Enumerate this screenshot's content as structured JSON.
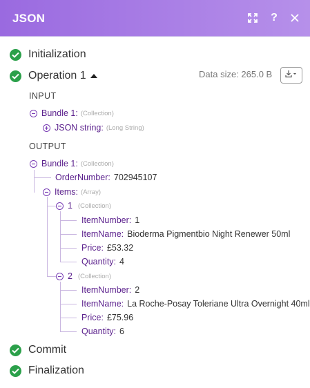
{
  "header": {
    "title": "JSON",
    "help_label": "?"
  },
  "stages": {
    "initialization": "Initialization",
    "operation": "Operation 1",
    "commit": "Commit",
    "finalization": "Finalization"
  },
  "operation": {
    "data_size": "Data size: 265.0 B"
  },
  "input": {
    "section_label": "INPUT",
    "bundle_key": "Bundle 1:",
    "bundle_type": "(Collection)",
    "json_key": "JSON string:",
    "json_type": "(Long String)"
  },
  "output": {
    "section_label": "OUTPUT",
    "bundle_key": "Bundle 1:",
    "bundle_type": "(Collection)",
    "order_key": "OrderNumber:",
    "order_value": "702945107",
    "items_key": "Items:",
    "items_type": "(Array)",
    "items": [
      {
        "index": "1",
        "type": "(Collection)",
        "item_number_key": "ItemNumber:",
        "item_number": "1",
        "item_name_key": "ItemName:",
        "item_name": "Bioderma Pigmentbio Night Renewer 50ml",
        "price_key": "Price:",
        "price": "£53.32",
        "quantity_key": "Quantity:",
        "quantity": "4"
      },
      {
        "index": "2",
        "type": "(Collection)",
        "item_number_key": "ItemNumber:",
        "item_number": "2",
        "item_name_key": "ItemName:",
        "item_name": "La Roche-Posay Toleriane Ultra Overnight 40ml",
        "price_key": "Price:",
        "price": "£75.96",
        "quantity_key": "Quantity:",
        "quantity": "6"
      }
    ]
  },
  "colors": {
    "header_start": "#9a6ae0",
    "header_end": "#b690ea",
    "success": "#2ba04a",
    "key": "#5a1f8c",
    "tree_line": "#c9b6e0"
  },
  "icons": {
    "expand": "expand-icon",
    "help": "help-icon",
    "close": "close-icon",
    "check": "check-circle-icon",
    "download": "download-icon",
    "collapse": "minus-circle-icon",
    "expand_node": "plus-circle-icon"
  }
}
